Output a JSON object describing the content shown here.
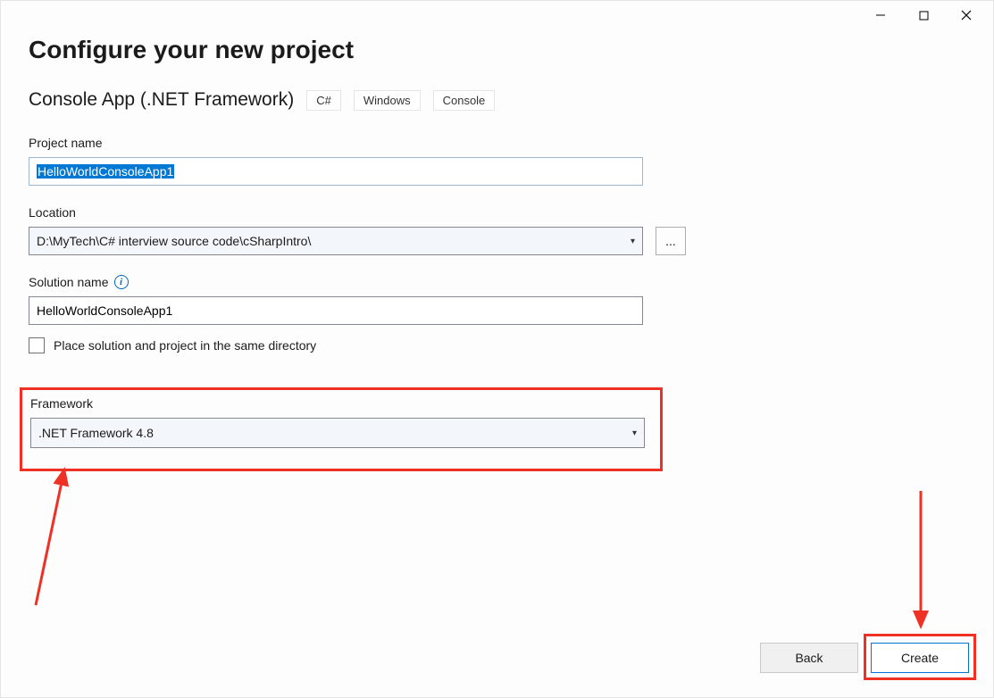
{
  "titlebar": {
    "minimize": "−",
    "maximize": "□",
    "close": "✕"
  },
  "page": {
    "title": "Configure your new project",
    "template_name": "Console App (.NET Framework)",
    "tags": [
      "C#",
      "Windows",
      "Console"
    ]
  },
  "fields": {
    "project_name_label": "Project name",
    "project_name_value": "HelloWorldConsoleApp1",
    "location_label": "Location",
    "location_value": "D:\\MyTech\\C# interview source code\\cSharpIntro\\",
    "browse_label": "...",
    "solution_label": "Solution name",
    "solution_info_tooltip": "i",
    "solution_value": "HelloWorldConsoleApp1",
    "same_dir_label": "Place solution and project in the same directory",
    "same_dir_checked": false,
    "framework_label": "Framework",
    "framework_value": ".NET Framework 4.8"
  },
  "footer": {
    "back_label": "Back",
    "create_label": "Create"
  },
  "annotation_color": "#ef3025"
}
